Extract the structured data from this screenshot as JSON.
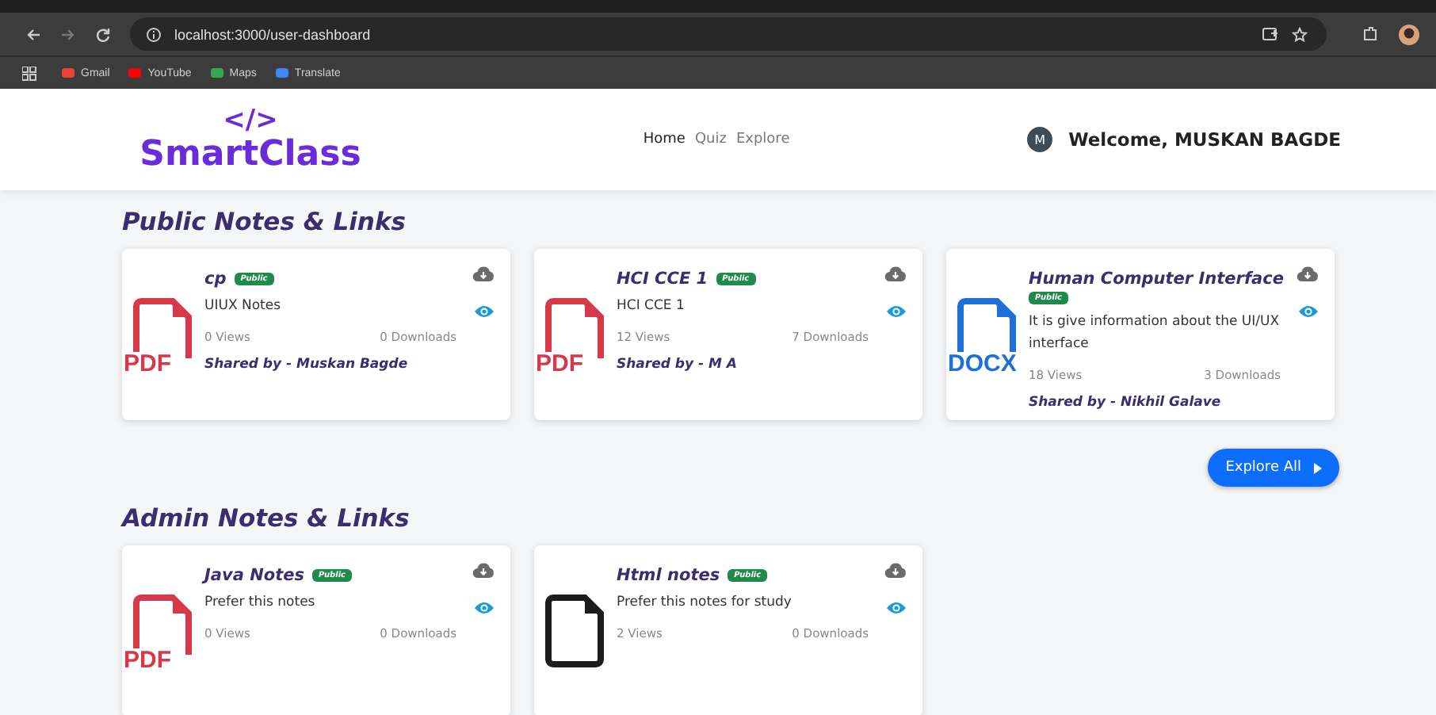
{
  "browser": {
    "url": "localhost:3000/user-dashboard",
    "bookmarks": [
      {
        "label": "Gmail",
        "color": "#ea4335"
      },
      {
        "label": "YouTube",
        "color": "#ff0000"
      },
      {
        "label": "Maps",
        "color": "#34a853"
      },
      {
        "label": "Translate",
        "color": "#4285f4"
      }
    ]
  },
  "header": {
    "logo_mark": "</>",
    "logo_text": "SmartClass",
    "nav": [
      {
        "label": "Home",
        "selected": true
      },
      {
        "label": "Quiz",
        "selected": false
      },
      {
        "label": "Explore",
        "selected": false
      }
    ],
    "avatar": "M",
    "welcome": "Welcome, MUSKAN BAGDE"
  },
  "sections": [
    {
      "title": "Public Notes & Links",
      "cards": [
        {
          "kind": "pdf",
          "file_label": "PDF",
          "title": "cp",
          "badge": "Public",
          "description": "UIUX Notes",
          "views": "0 Views",
          "downloads": "0 Downloads",
          "shared_by": "Shared by - Muskan Bagde"
        },
        {
          "kind": "pdf",
          "file_label": "PDF",
          "title": "HCI CCE 1",
          "badge": "Public",
          "description": "HCI CCE 1",
          "views": "12 Views",
          "downloads": "7 Downloads",
          "shared_by": "Shared by - M A"
        },
        {
          "kind": "docx",
          "file_label": "DOCX",
          "title": "Human Computer Interface",
          "badge": "Public",
          "description": "It is give information about the UI/UX interface",
          "views": "18 Views",
          "downloads": "3 Downloads",
          "shared_by": "Shared by - Nikhil Galave"
        }
      ],
      "button": "Explore All"
    },
    {
      "title": "Admin Notes & Links",
      "cards": [
        {
          "kind": "pdf",
          "file_label": "PDF",
          "title": "Java Notes",
          "badge": "Public",
          "description": "Prefer this notes",
          "views": "0 Views",
          "downloads": "0 Downloads"
        },
        {
          "kind": "file",
          "title": "Html notes",
          "badge": "Public",
          "description": "Prefer this notes for study",
          "views": "2 Views",
          "downloads": "0 Downloads"
        }
      ]
    }
  ]
}
